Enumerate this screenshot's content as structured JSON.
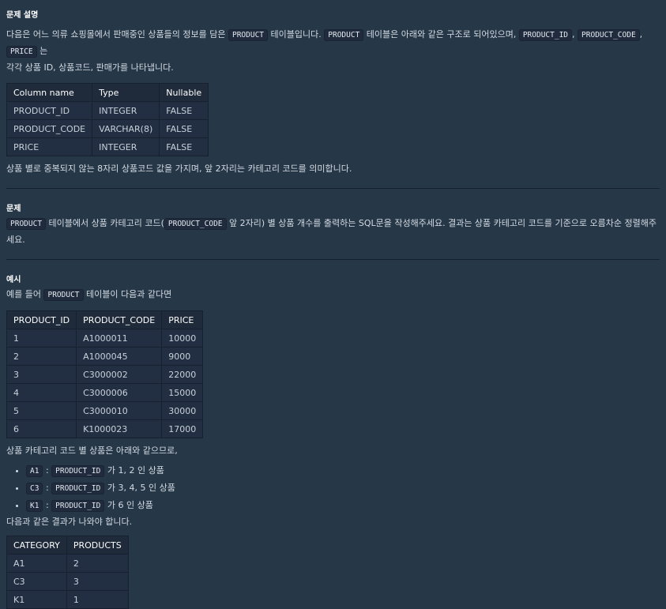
{
  "sections": {
    "desc_heading": "문제 설명",
    "problem_heading": "문제",
    "example_heading": "예시"
  },
  "desc": {
    "line1_a": "다음은 어느 의류 쇼핑몰에서 판매중인 상품들의 정보를 담은",
    "code_product": "PRODUCT",
    "line1_b": "테이블입니다.",
    "line1_c": "테이블은 아래와 같은 구조로 되어있으며,",
    "code_product_id": "PRODUCT_ID",
    "sep1": ",",
    "code_product_code": "PRODUCT_CODE",
    "sep2": ",",
    "code_price": "PRICE",
    "line1_d": "는",
    "line2": "각각 상품 ID, 상품코드, 판매가를 나타냅니다.",
    "note": "상품 별로 중복되지 않는 8자리 상품코드 값을 가지며, 앞 2자리는 카테고리 코드를 의미합니다."
  },
  "schema_table": {
    "headers": [
      "Column name",
      "Type",
      "Nullable"
    ],
    "rows": [
      [
        "PRODUCT_ID",
        "INTEGER",
        "FALSE"
      ],
      [
        "PRODUCT_CODE",
        "VARCHAR(8)",
        "FALSE"
      ],
      [
        "PRICE",
        "INTEGER",
        "FALSE"
      ]
    ]
  },
  "problem": {
    "code_product": "PRODUCT",
    "text_a": "테이블에서 상품 카테고리 코드(",
    "code_product_code": "PRODUCT_CODE",
    "text_b": "앞 2자리) 별 상품 개수를 출력하는 SQL문을 작성해주세요. 결과는 상품 카테고리 코드를 기준으로 오름차순 정렬해주세요."
  },
  "example": {
    "intro_a": "예를 들어",
    "code_product": "PRODUCT",
    "intro_b": "테이블이 다음과 같다면",
    "after_table": "상품 카테고리 코드 별 상품은 아래와 같으므로,",
    "bullets": [
      {
        "code": "A1",
        "colon": ":",
        "col": "PRODUCT_ID",
        "text": "가 1, 2 인 상품"
      },
      {
        "code": "C3",
        "colon": ":",
        "col": "PRODUCT_ID",
        "text": "가 3, 4, 5 인 상품"
      },
      {
        "code": "K1",
        "colon": ":",
        "col": "PRODUCT_ID",
        "text": "가 6 인 상품"
      }
    ],
    "result_intro": "다음과 같은 결과가 나와야 합니다."
  },
  "product_table": {
    "headers": [
      "PRODUCT_ID",
      "PRODUCT_CODE",
      "PRICE"
    ],
    "rows": [
      [
        "1",
        "A1000011",
        "10000"
      ],
      [
        "2",
        "A1000045",
        "9000"
      ],
      [
        "3",
        "C3000002",
        "22000"
      ],
      [
        "4",
        "C3000006",
        "15000"
      ],
      [
        "5",
        "C3000010",
        "30000"
      ],
      [
        "6",
        "K1000023",
        "17000"
      ]
    ]
  },
  "result_table": {
    "headers": [
      "CATEGORY",
      "PRODUCTS"
    ],
    "rows": [
      [
        "A1",
        "2"
      ],
      [
        "C3",
        "3"
      ],
      [
        "K1",
        "1"
      ]
    ]
  }
}
